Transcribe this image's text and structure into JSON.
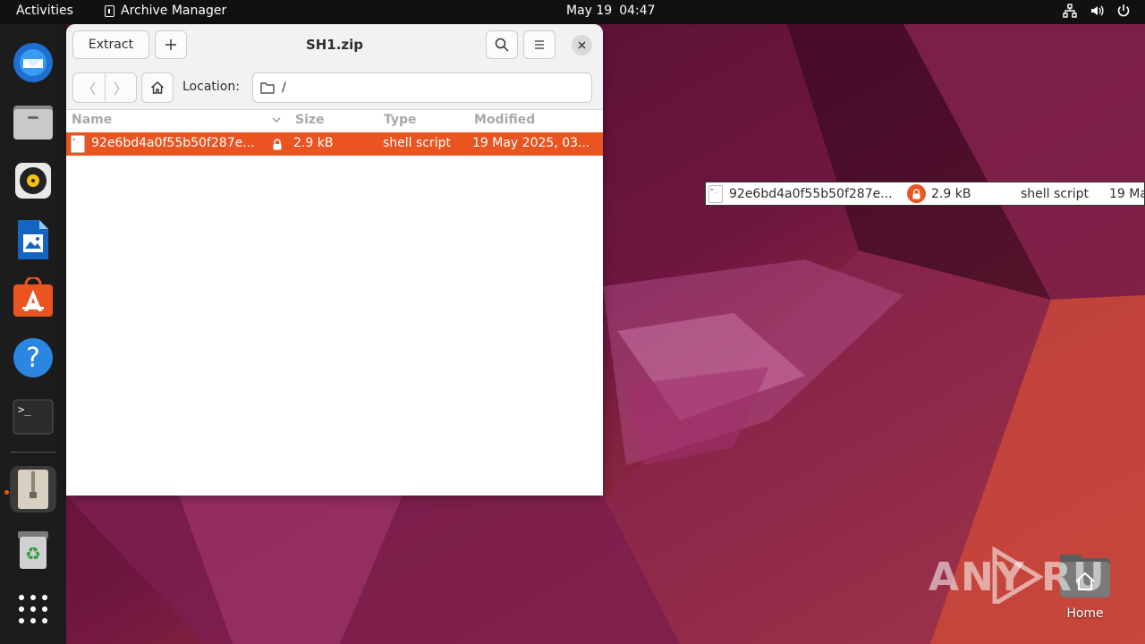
{
  "topbar": {
    "activities": "Activities",
    "app_name": "Archive Manager",
    "date": "May 19",
    "time": "04:47"
  },
  "dock": {
    "items": [
      "thunderbird-icon",
      "files-icon",
      "rhythmbox-icon",
      "libreoffice-writer-icon",
      "app-center-icon",
      "help-icon",
      "terminal-icon",
      "archive-manager-icon",
      "trash-icon",
      "show-apps-icon"
    ],
    "accent": "#e95420"
  },
  "window": {
    "title": "SH1.zip",
    "extract_label": "Extract",
    "location_label": "Location:",
    "location_value": "/",
    "columns": {
      "name": "Name",
      "size": "Size",
      "type": "Type",
      "modified": "Modified"
    },
    "rows": [
      {
        "name": "92e6bd4a0f55b50f287e...",
        "size": "2.9 kB",
        "type": "shell script",
        "modified": "19 May 2025, 03..."
      }
    ]
  },
  "drag_ghost": {
    "name": "92e6bd4a0f55b50f287e...",
    "size": "2.9 kB",
    "type": "shell script",
    "modified": "19 Ma"
  },
  "desktop": {
    "home_label": "Home",
    "watermark": "ANY RUN"
  }
}
